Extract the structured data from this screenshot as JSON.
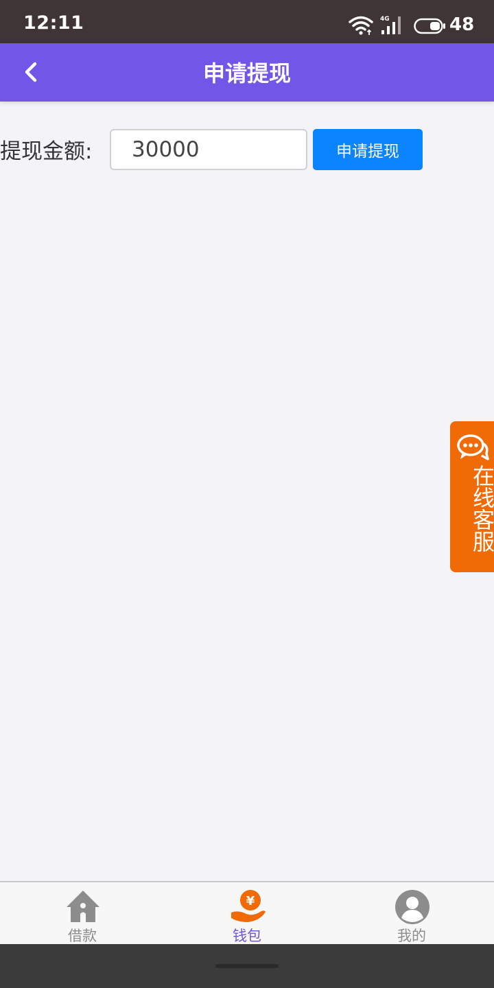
{
  "status_bar": {
    "time": "12:11",
    "network": "4G",
    "battery_percent": "48"
  },
  "header": {
    "title": "申请提现",
    "back_icon": "chevron-left-icon"
  },
  "form": {
    "amount_label": "提现金额:",
    "amount_value": "30000",
    "submit_label": "申请提现"
  },
  "service": {
    "label": "在线客服",
    "icon": "chat-bubbles-icon"
  },
  "tabs": [
    {
      "label": "借款",
      "icon": "home-icon",
      "active": false
    },
    {
      "label": "钱包",
      "icon": "wallet-yuan-icon",
      "active": true
    },
    {
      "label": "我的",
      "icon": "user-icon",
      "active": false
    }
  ],
  "colors": {
    "header": "#7256e8",
    "button": "#0a84ff",
    "service": "#f06a05",
    "tab_active": "#6f57d8",
    "tab_inactive": "#8d8d8d"
  }
}
